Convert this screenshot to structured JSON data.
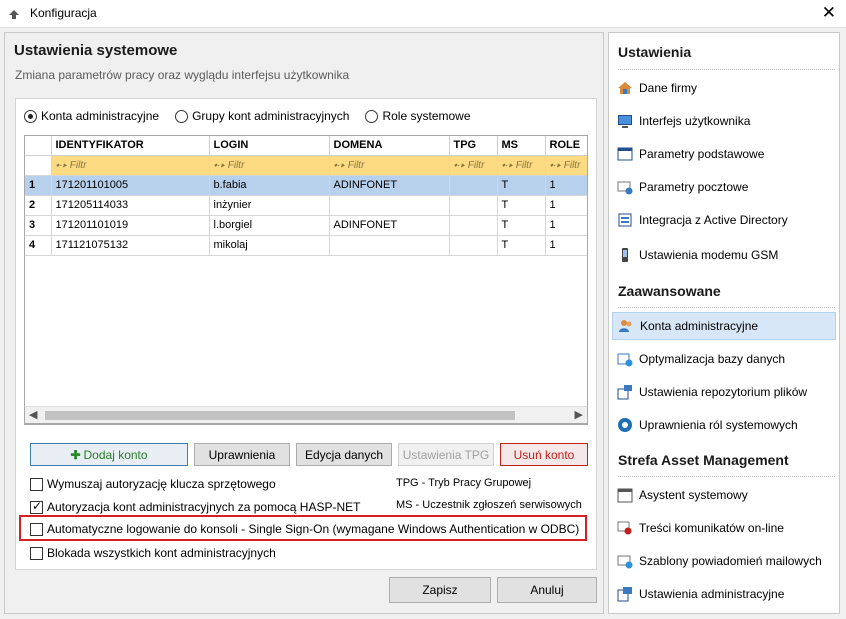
{
  "window": {
    "title": "Konfiguracja",
    "close": "✕"
  },
  "main": {
    "title": "Ustawienia systemowe",
    "subtitle": "Zmiana parametrów pracy oraz wyglądu interfejsu użytkownika",
    "radios": [
      {
        "label": "Konta administracyjne",
        "selected": true
      },
      {
        "label": "Grupy kont administracyjnych",
        "selected": false
      },
      {
        "label": "Role systemowe",
        "selected": false
      }
    ],
    "table": {
      "columns": [
        "IDENTYFIKATOR",
        "LOGIN",
        "DOMENA",
        "TPG",
        "MS",
        "ROLE"
      ],
      "filter_text": "Filtr",
      "rows": [
        {
          "num": "1",
          "id": "171201101005",
          "login": "b.fabia",
          "domain": "ADINFONET",
          "tpg": "",
          "ms": "T",
          "role": "1"
        },
        {
          "num": "2",
          "id": "171205114033",
          "login": "inżynier",
          "domain": "",
          "tpg": "",
          "ms": "T",
          "role": "1"
        },
        {
          "num": "3",
          "id": "171201101019",
          "login": "l.borgiel",
          "domain": "ADINFONET",
          "tpg": "",
          "ms": "T",
          "role": "1"
        },
        {
          "num": "4",
          "id": "171121075132",
          "login": "mikolaj",
          "domain": "",
          "tpg": "",
          "ms": "T",
          "role": "1"
        }
      ]
    },
    "buttons": {
      "add": "Dodaj konto",
      "permissions": "Uprawnienia",
      "edit": "Edycja danych",
      "tpg": "Ustawienia TPG",
      "delete": "Usuń konto"
    },
    "checkboxes": [
      {
        "label": "Wymuszaj autoryzację klucza sprzętowego",
        "checked": false
      },
      {
        "label": "Autoryzacja kont administracyjnych za pomocą HASP-NET",
        "checked": true
      },
      {
        "label": "Automatyczne logowanie do konsoli - Single Sign-On (wymagane Windows Authentication w ODBC)",
        "checked": false
      },
      {
        "label": "Blokada wszystkich kont administracyjnych",
        "checked": false
      }
    ],
    "legend": {
      "tpg": "TPG - Tryb Pracy Grupowej",
      "ms": "MS - Uczestnik zgłoszeń serwisowych"
    },
    "footer": {
      "save": "Zapisz",
      "cancel": "Anuluj"
    }
  },
  "sidebar": {
    "sections": [
      {
        "title": "Ustawienia",
        "items": [
          {
            "label": "Dane firmy",
            "icon": "house-icon"
          },
          {
            "label": "Interfejs użytkownika",
            "icon": "monitor-icon"
          },
          {
            "label": "Parametry podstawowe",
            "icon": "window-icon"
          },
          {
            "label": "Parametry pocztowe",
            "icon": "mail-check-icon"
          },
          {
            "label": "Integracja z Active Directory",
            "icon": "directory-icon"
          },
          {
            "label": "Ustawienia modemu GSM",
            "icon": "phone-icon"
          }
        ]
      },
      {
        "title": "Zaawansowane",
        "items": [
          {
            "label": "Konta administracyjne",
            "icon": "users-icon",
            "active": true
          },
          {
            "label": "Optymalizacja bazy danych",
            "icon": "database-icon"
          },
          {
            "label": "Ustawienia repozytorium plików",
            "icon": "repository-icon"
          },
          {
            "label": "Uprawnienia ról systemowych",
            "icon": "roles-icon"
          }
        ]
      },
      {
        "title": "Strefa Asset Management",
        "items": [
          {
            "label": "Asystent systemowy",
            "icon": "calendar-icon"
          },
          {
            "label": "Treści komunikatów on-line",
            "icon": "message-icon"
          },
          {
            "label": "Szablony powiadomień mailowych",
            "icon": "mail-template-icon"
          },
          {
            "label": "Ustawienia administracyjne",
            "icon": "admin-settings-icon"
          }
        ]
      }
    ]
  }
}
